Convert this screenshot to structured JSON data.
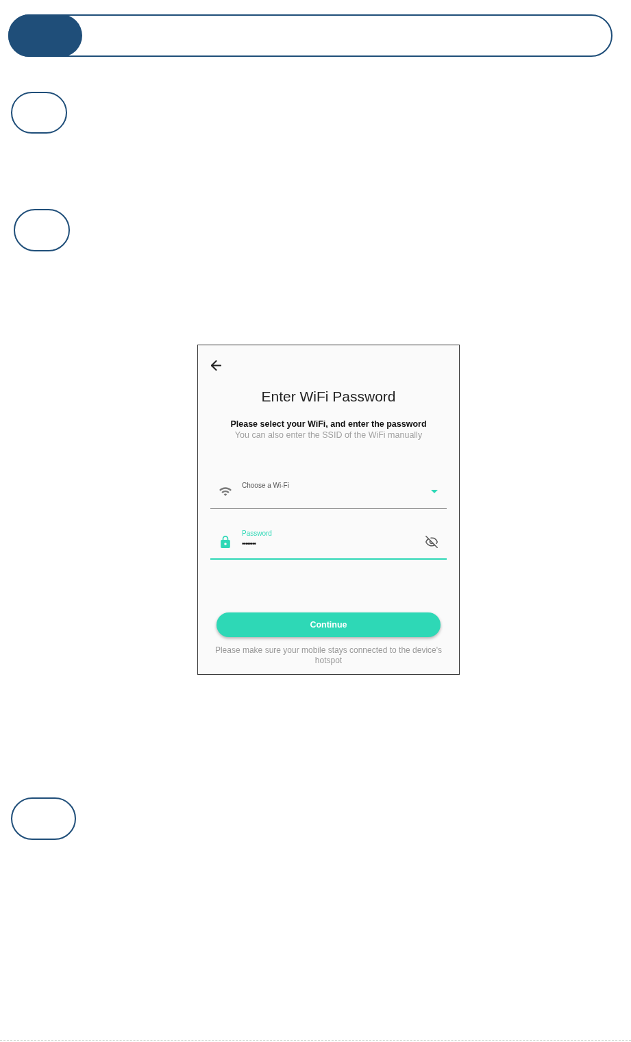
{
  "screen": {
    "title": "Enter WiFi Password",
    "subtitle": "Please select your WiFi, and enter the password",
    "hint": "You can also enter the SSID of the WiFi manually",
    "fields": [
      {
        "kind": "select",
        "label": "Choose a Wi-Fi",
        "focused": false
      },
      {
        "kind": "password",
        "label": "Password",
        "value": "••••••••",
        "focused": true
      }
    ],
    "button": "Continue",
    "note": "Please make sure your mobile stays connected to the device's hotspot"
  }
}
